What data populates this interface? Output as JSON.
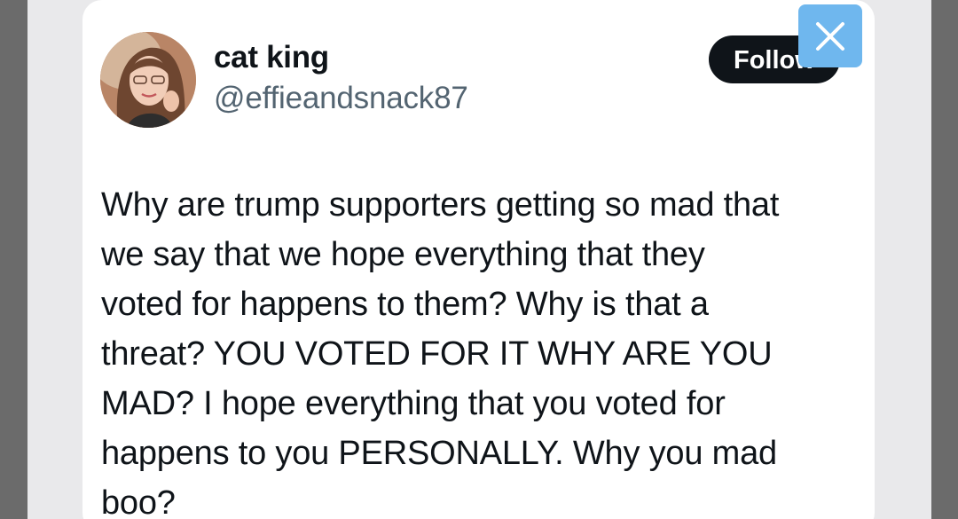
{
  "post": {
    "author": {
      "display_name": "cat king",
      "handle": "@effieandsnack87",
      "avatar_icon": "profile-photo"
    },
    "follow_label": "Follow",
    "close_icon": "close-icon",
    "text_lines": [
      "Why are trump supporters getting so mad that",
      "we say that we hope everything that they",
      "voted for happens to them? Why is that a",
      "threat? YOU VOTED FOR IT WHY ARE YOU",
      "MAD? I hope everything that you voted for",
      "happens to you PERSONALLY. Why you mad",
      "boo?"
    ]
  },
  "colors": {
    "follow_button_bg": "#0f1419",
    "close_button_bg": "#6fb7ee",
    "handle_text": "#536471",
    "card_bg": "#ffffff",
    "frame_bg": "#e9e9eb",
    "outer_bg": "#6b6b6b"
  }
}
